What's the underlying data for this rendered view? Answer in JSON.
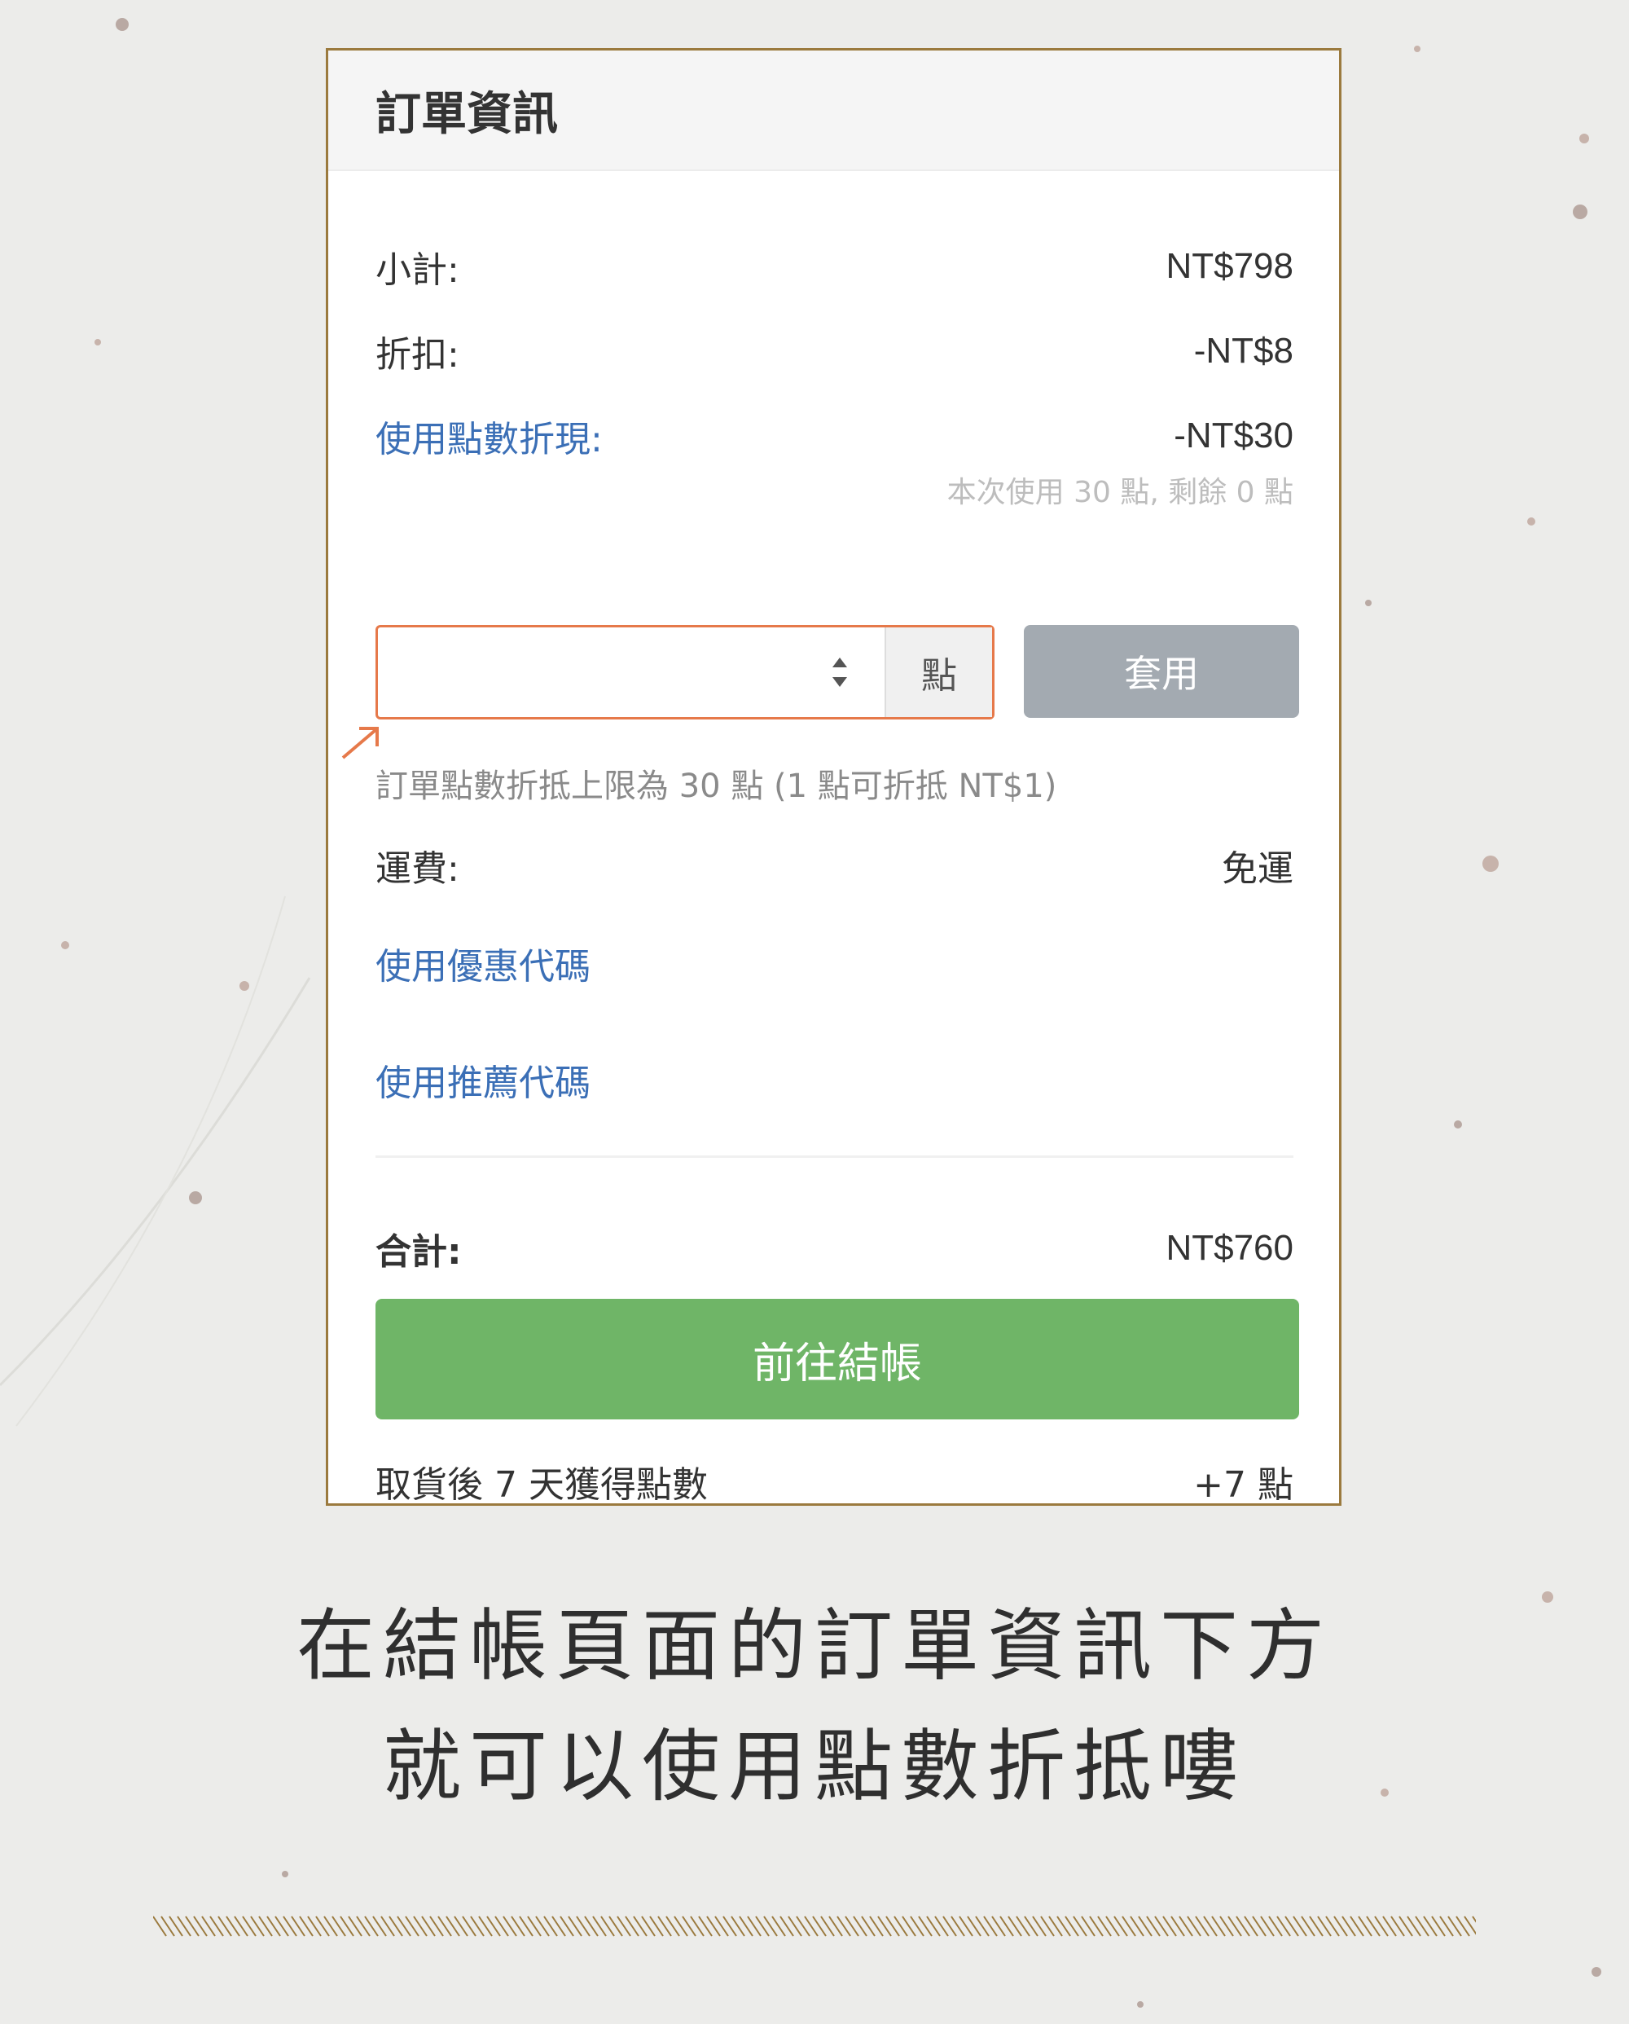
{
  "card": {
    "title": "訂單資訊",
    "subtotal": {
      "label": "小計:",
      "value": "NT$798"
    },
    "discount": {
      "label": "折扣:",
      "value": "-NT$8"
    },
    "points": {
      "label": "使用點數折現:",
      "value": "-NT$30",
      "usage_note": "本次使用 30 點, 剩餘 0 點",
      "input_value": "",
      "unit": "點",
      "apply_label": "套用",
      "hint": "訂單點數折抵上限為 30 點 (1 點可折抵 NT$1)"
    },
    "shipping": {
      "label": "運費:",
      "value": "免運"
    },
    "coupon_link": "使用優惠代碼",
    "referral_link": "使用推薦代碼",
    "total": {
      "label": "合計:",
      "value": "NT$760"
    },
    "checkout_label": "前往結帳",
    "earn": {
      "label": "取貨後 7 天獲得點數",
      "value": "+7 點"
    }
  },
  "caption": {
    "line1": "在結帳頁面的訂單資訊下方",
    "line2": "就可以使用點數折抵嘍"
  },
  "colors": {
    "card_border": "#9b7a3e",
    "link": "#3b6fb6",
    "input_highlight": "#e6794a",
    "apply_button": "#a3aab1",
    "checkout_button": "#6fb567",
    "background": "#ececea"
  }
}
